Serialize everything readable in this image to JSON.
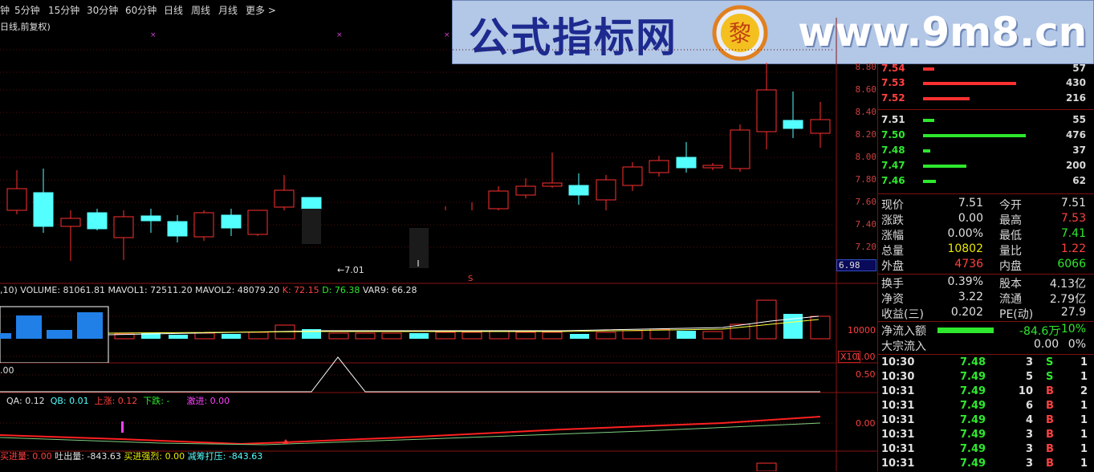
{
  "toolbar": {
    "periods": [
      "钟",
      "5分钟",
      "15分钟",
      "30分钟",
      "60分钟",
      "日线",
      "周线",
      "月线",
      "更多 >"
    ],
    "chart_mode": "日线,前复权)"
  },
  "banner": {
    "title": "公式指标网",
    "url": "www.9m8.cn",
    "logo_text": "www.9m8.cn"
  },
  "main_chart": {
    "price_ticks": [
      "8.80",
      "8.60",
      "8.40",
      "8.20",
      "8.00",
      "7.80",
      "7.60",
      "7.40",
      "7.20"
    ],
    "low_marker": "←7.01",
    "current_price_tag": "6.98",
    "s_marker": "S"
  },
  "volume_panel": {
    "header": ",10)  VOLUME: 81061.81  MAVOL1: 72511.20  MAVOL2: 48079.20",
    "k": "K: 72.15",
    "d": "D: 76.38",
    "var9": "VAR9: 66.28",
    "tick": "10000",
    "multiplier": "X10"
  },
  "indicator1": {
    "value": ".00",
    "ticks": [
      "1.00",
      "0.50"
    ]
  },
  "indicator2": {
    "qa": "QA: 0.12",
    "qb": "QB: 0.01",
    "up": "上涨: 0.12",
    "down": "下跌: -",
    "advance": "激进: 0.00",
    "tick": "0.00"
  },
  "bottom_legend": {
    "a": "买进量: 0.00",
    "b": "吐出量: -843.63",
    "c": "买进强烈: 0.00",
    "d": "减筹打压: -843.63"
  },
  "order_book": {
    "asks": [
      {
        "price": "7.54",
        "qty": "57"
      },
      {
        "price": "7.53",
        "qty": "430"
      },
      {
        "price": "7.52",
        "qty": "216"
      }
    ],
    "bids": [
      {
        "price": "7.51",
        "qty": "55"
      },
      {
        "price": "7.50",
        "qty": "476"
      },
      {
        "price": "7.48",
        "qty": "37"
      },
      {
        "price": "7.47",
        "qty": "200"
      },
      {
        "price": "7.46",
        "qty": "62"
      }
    ]
  },
  "quote": {
    "rows": [
      {
        "l1": "现价",
        "v1": "7.51",
        "l2": "今开",
        "v2": "7.51"
      },
      {
        "l1": "涨跌",
        "v1": "0.00",
        "l2": "最高",
        "v2": "7.53"
      },
      {
        "l1": "涨幅",
        "v1": "0.00%",
        "l2": "最低",
        "v2": "7.41"
      },
      {
        "l1": "总量",
        "v1": "10802",
        "l2": "量比",
        "v2": "1.22"
      },
      {
        "l1": "外盘",
        "v1": "4736",
        "l2": "内盘",
        "v2": "6066"
      }
    ],
    "rows2": [
      {
        "l1": "换手",
        "v1": "0.39%",
        "l2": "股本",
        "v2": "4.13亿"
      },
      {
        "l1": "净资",
        "v1": "3.22",
        "l2": "流通",
        "v2": "2.79亿"
      },
      {
        "l1": "收益(三)",
        "v1": "0.202",
        "l2": "PE(动)",
        "v2": "27.9"
      }
    ],
    "net_inflow_label": "净流入额",
    "net_inflow_value": "-84.6万",
    "net_inflow_pct": "-10%",
    "block_label": "大宗流入",
    "block_value": "0.00",
    "block_pct": "0%"
  },
  "ticks": [
    {
      "time": "10:30",
      "price": "7.48",
      "vol": "3",
      "bs": "S",
      "n": "1"
    },
    {
      "time": "10:30",
      "price": "7.49",
      "vol": "5",
      "bs": "S",
      "n": "1"
    },
    {
      "time": "10:31",
      "price": "7.49",
      "vol": "10",
      "bs": "B",
      "n": "2"
    },
    {
      "time": "10:31",
      "price": "7.49",
      "vol": "6",
      "bs": "B",
      "n": "1"
    },
    {
      "time": "10:31",
      "price": "7.49",
      "vol": "4",
      "bs": "B",
      "n": "1"
    },
    {
      "time": "10:31",
      "price": "7.49",
      "vol": "3",
      "bs": "B",
      "n": "1"
    },
    {
      "time": "10:31",
      "price": "7.49",
      "vol": "3",
      "bs": "B",
      "n": "1"
    },
    {
      "time": "10:31",
      "price": "7.49",
      "vol": "3",
      "bs": "B",
      "n": "1"
    }
  ],
  "colors": {
    "up": "#ff3030",
    "down": "#54ffff",
    "grid": "#7a1010",
    "text": "#c0c0c0"
  }
}
